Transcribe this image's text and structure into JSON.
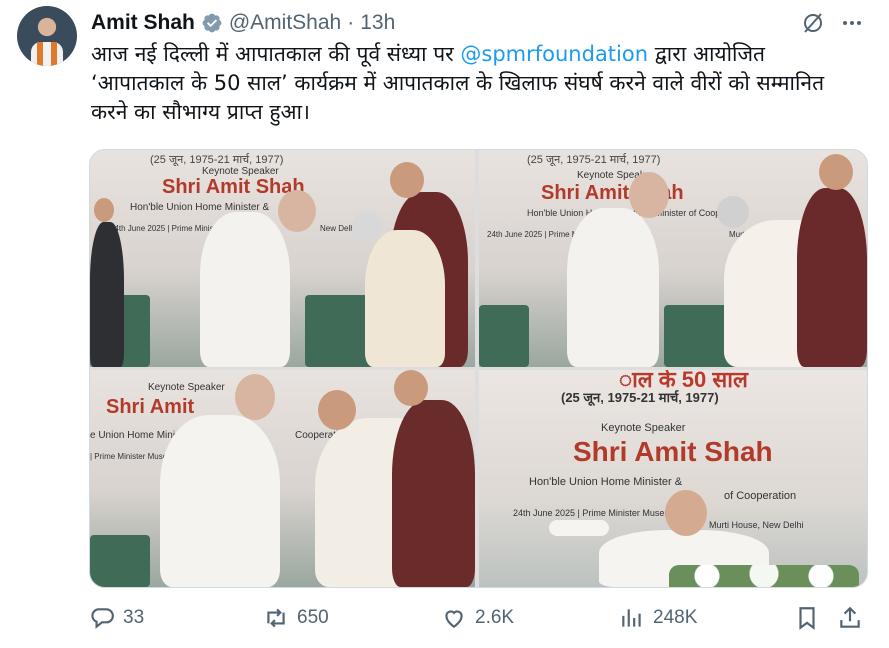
{
  "tweet": {
    "author_name": "Amit Shah",
    "handle": "@AmitShah",
    "separator": "·",
    "time": "13h",
    "text_part1": "आज नई दिल्ली में आपातकाल की पूर्व संध्या पर ",
    "mention": "@spmrfoundation",
    "text_part2": " द्वारा आयोजित ‘आपातकाल के 50 साल’ कार्यक्रम में आपातकाल के खिलाफ संघर्ष करने वाले वीरों को सम्मानित करने का सौभाग्य प्राप्त हुआ।"
  },
  "photos": {
    "p1": {
      "date": "(25 जून, 1975-21 मार्च, 1977)",
      "speaker_caption": "Keynote Speaker",
      "speaker": "Shri Amit Shah",
      "role": "Hon'ble Union Home Minister &",
      "venue": "24th June 2025 | Prime Minister Museum",
      "city": "New Delhi"
    },
    "p2": {
      "date": "(25 जून, 1975-21 मार्च, 1977)",
      "speaker_caption": "Keynote Speaker",
      "speaker": "Shri Amit Shah",
      "role": "Hon'ble Union Home Minister & Minister of Cooperation",
      "venue": "24th June 2025 | Prime Minister",
      "city": "Murti House, New Delhi"
    },
    "p3": {
      "speaker_caption": "Keynote Speaker",
      "speaker": "Shri Amit",
      "role": "e Union Home Minister",
      "role2": "Cooperation",
      "venue": "| Prime Minister Museum"
    },
    "p4": {
      "title_top": "ाल के 50 साल",
      "date": "(25 जून, 1975-21 मार्च, 1977)",
      "speaker_caption": "Keynote Speaker",
      "speaker": "Shri Amit Shah",
      "role": "Hon'ble Union Home Minister &",
      "role2": "of Cooperation",
      "venue": "24th June 2025 | Prime Minister Museum &",
      "city": "Murti House, New Delhi"
    }
  },
  "actions": {
    "replies": "33",
    "reposts": "650",
    "likes": "2.6K",
    "views": "248K"
  },
  "icons": {
    "verified": "verified-badge-icon",
    "grok": "grok-icon",
    "more": "more-icon",
    "reply": "reply-icon",
    "repost": "repost-icon",
    "like": "like-icon",
    "views": "views-icon",
    "bookmark": "bookmark-icon",
    "share": "share-icon"
  },
  "colors": {
    "accent": "#1d9bf0",
    "muted": "#536471",
    "banner_red": "#b23a2a"
  }
}
